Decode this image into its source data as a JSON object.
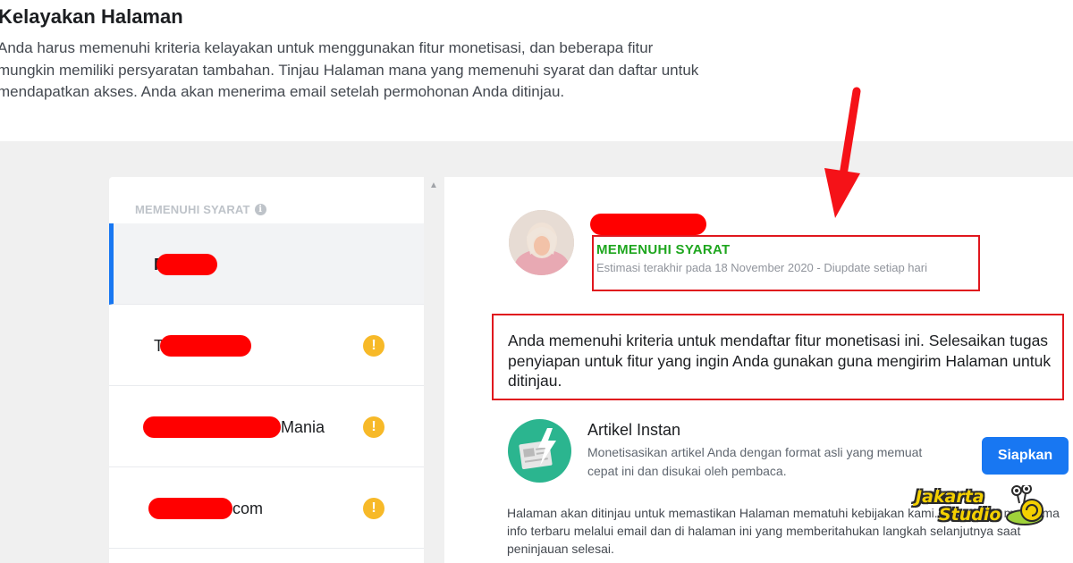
{
  "header": {
    "title": "Kelayakan Halaman",
    "description": "Anda harus memenuhi kriteria kelayakan untuk menggunakan fitur monetisasi, dan beberapa fitur mungkin memiliki persyaratan tambahan. Tinjau Halaman mana yang memenuhi syarat dan daftar untuk mendapatkan akses. Anda akan menerima email setelah permohonan Anda ditinjau."
  },
  "sidebar": {
    "section_label": "MEMENUHI SYARAT",
    "info_icon": "info-icon",
    "items": [
      {
        "visible_text": "F",
        "warning": false,
        "active": true
      },
      {
        "visible_text": "T",
        "warning": true,
        "active": false
      },
      {
        "visible_text": "Mania",
        "warning": true,
        "active": false
      },
      {
        "visible_text": "com",
        "warning": true,
        "active": false
      }
    ],
    "warning_glyph": "!"
  },
  "detail": {
    "status": "MEMENUHI SYARAT",
    "status_sub": "Estimasi terakhir pada 18 November 2020 - Diupdate setiap hari",
    "message": "Anda memenuhi kriteria untuk mendaftar fitur monetisasi ini. Selesaikan tugas penyiapan untuk fitur yang ingin Anda gunakan guna mengirim Halaman untuk ditinjau.",
    "feature": {
      "title": "Artikel Instan",
      "description": "Monetisasikan artikel Anda dengan format asli yang memuat cepat ini dan disukai oleh pembaca.",
      "button_label": "Siapkan",
      "icon": "instant-articles-icon"
    },
    "footer_note": "Halaman akan ditinjau untuk memastikan Halaman mematuhi kebijakan kami. Anda akan menerima info terbaru melalui email dan di halaman ini yang memberitahukan langkah selanjutnya saat peninjauan selesai."
  },
  "watermark": {
    "line1": "Jakarta",
    "line2": "Studio"
  },
  "colors": {
    "accent": "#1877f2",
    "eligible_green": "#1ea61e",
    "warning": "#f7b928",
    "annotation_red": "#e0171e"
  }
}
